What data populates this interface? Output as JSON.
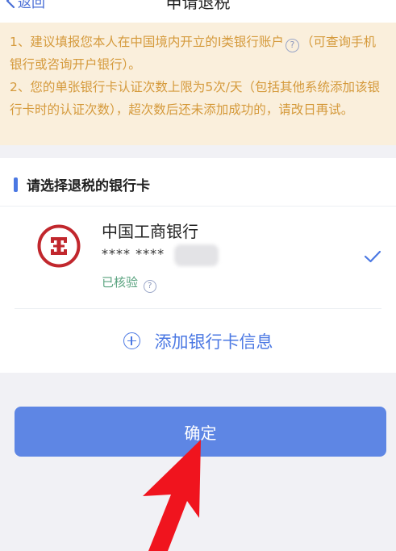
{
  "header": {
    "back_label": "返回",
    "title": "申请退税"
  },
  "notice": {
    "line1_before": "1、建议填报您本人在中国境内开立的Ⅰ类银行账户",
    "line1_after": "（可查询手机银行或咨询开户银行）。",
    "line2": "2、您的单张银行卡认证次数上限为5次/天（包括其他系统添加该银行卡时的认证次数），超次数后还未添加成功的，请改日再试。",
    "question_mark": "?"
  },
  "section": {
    "title": "请选择退税的银行卡"
  },
  "bank_card": {
    "name": "中国工商银行",
    "number_masked": "**** ****",
    "status": "已核验",
    "selected": true
  },
  "add_card": {
    "label": "添加银行卡信息"
  },
  "confirm_button": {
    "label": "确定"
  },
  "colors": {
    "accent": "#4b78e3",
    "button": "#5e86e4",
    "notice_bg": "#faefdc",
    "notice_text": "#d59a3c",
    "verified": "#58a27e",
    "icbc_red": "#c1272d",
    "annotation_arrow": "#f0141e"
  },
  "icons": [
    "chevron-left-icon",
    "help-circle-icon",
    "icbc-logo",
    "checkmark-icon",
    "plus-circle-icon",
    "red-arrow-annotation"
  ]
}
